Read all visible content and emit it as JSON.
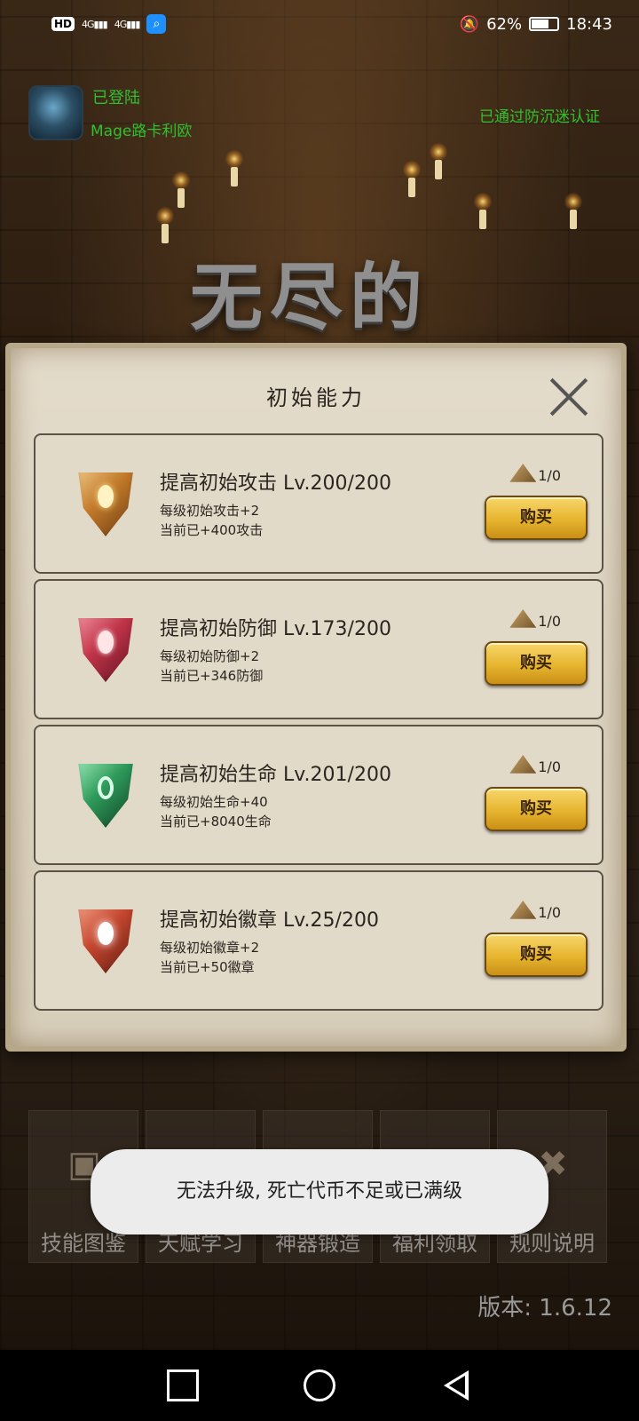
{
  "status_bar": {
    "hd": "HD",
    "signal1": "4G",
    "signal2": "4G",
    "battery": "62%",
    "time": "18:43",
    "icons": [
      "hd-icon",
      "signal-icon",
      "search-app-icon",
      "bell-off-icon",
      "battery-icon"
    ]
  },
  "login": {
    "status": "已登陆",
    "username": "Mage路卡利欧",
    "anti_addiction": "已通过防沉迷认证"
  },
  "game_title": "无尽的",
  "dialog": {
    "title": "初始能力",
    "buy_label": "购买",
    "items": [
      {
        "name": "提高初始攻击 Lv.200/200",
        "per_level": "每级初始攻击+2",
        "current": "当前已+400攻击",
        "cost": "1/0",
        "gem": "attack"
      },
      {
        "name": "提高初始防御 Lv.173/200",
        "per_level": "每级初始防御+2",
        "current": "当前已+346防御",
        "cost": "1/0",
        "gem": "defense"
      },
      {
        "name": "提高初始生命 Lv.201/200",
        "per_level": "每级初始生命+40",
        "current": "当前已+8040生命",
        "cost": "1/0",
        "gem": "life"
      },
      {
        "name": "提高初始徽章 Lv.25/200",
        "per_level": "每级初始徽章+2",
        "current": "当前已+50徽章",
        "cost": "1/0",
        "gem": "badge"
      }
    ]
  },
  "tabs": [
    {
      "label": "技能图鉴",
      "icon": "skill-book-icon"
    },
    {
      "label": "天赋学习",
      "icon": "talent-icon"
    },
    {
      "label": "神器锻造",
      "icon": "forge-icon"
    },
    {
      "label": "福利领取",
      "icon": "gift-icon"
    },
    {
      "label": "规则说明",
      "icon": "rules-icon"
    }
  ],
  "toast": "无法升级, 死亡代币不足或已满级",
  "version": "版本: 1.6.12"
}
